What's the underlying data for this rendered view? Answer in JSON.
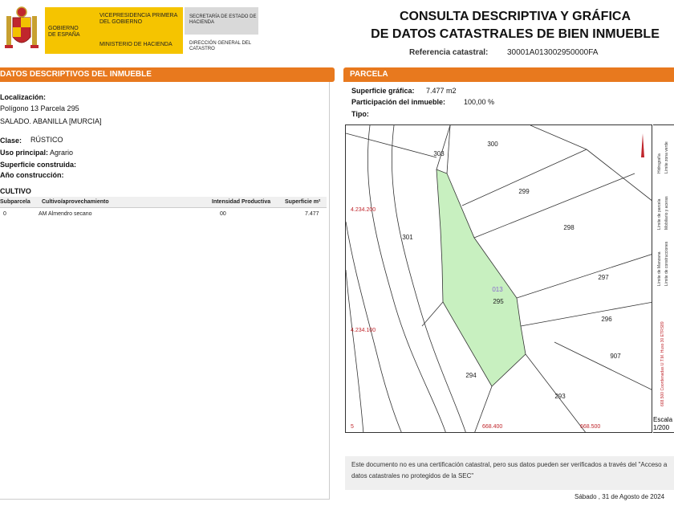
{
  "header": {
    "gobierno": "GOBIERNO DE ESPAÑA",
    "vicepresidencia": "VICEPRESIDENCIA PRIMERA DEL GOBIERNO",
    "ministerio": "MINISTERIO DE HACIENDA",
    "secretaria": "SECRETARÍA DE ESTADO DE HACIENDA",
    "direccion": "DIRECCIÓN GENERAL DEL CATASTRO",
    "title_line1": "CONSULTA DESCRIPTIVA Y GRÁFICA",
    "title_line2": "DE DATOS CATASTRALES DE BIEN INMUEBLE",
    "ref_label": "Referencia catastral:",
    "ref_value": "30001A013002950000FA"
  },
  "left": {
    "section_title": "DATOS DESCRIPTIVOS DEL INMUEBLE",
    "localizacion_label": "Localización:",
    "localizacion_line1": "Polígono 13 Parcela 295",
    "localizacion_line2": "SALADO. ABANILLA [MURCIA]",
    "clase_label": "Clase:",
    "clase_value": "RÚSTICO",
    "uso_label": "Uso principal:",
    "uso_value": "Agrario",
    "superficie_label": "Superficie construida:",
    "anio_label": "Año construcción:",
    "cultivo_title": "CULTIVO",
    "table_headers": [
      "Subparcela",
      "Cultivo/aprovechamiento",
      "Intensidad Productiva",
      "Superficie m²"
    ],
    "table_rows": [
      [
        "0",
        "AM Almendro secano",
        "00",
        "7.477"
      ]
    ]
  },
  "right": {
    "section_title": "PARCELA",
    "superficie_label": "Superficie gráfica:",
    "superficie_value": "7.477 m2",
    "participacion_label": "Participación del inmueble:",
    "participacion_value": "100,00 %",
    "tipo_label": "Tipo:"
  },
  "map": {
    "parcels": [
      "300",
      "303",
      "299",
      "298",
      "301",
      "297",
      "013",
      "295",
      "296",
      "294",
      "907",
      "293"
    ],
    "coords": [
      "4.234.200",
      "4.234.100",
      "668.400",
      "668.500"
    ],
    "y_first_char": "5",
    "highlight_color": "#c8f0c0"
  },
  "legend": {
    "items": [
      "Hidrografía",
      "Límite zona verde",
      "Límite de parcela",
      "Mobiliario y aceras",
      "Límite de Manzana",
      "Límite de construcciones"
    ],
    "coords_text": "668.500 Coordenadas U.T.M. Huso 30 ETRS89",
    "scale_label": "Escala",
    "scale_value": "1/200"
  },
  "footer": {
    "note": "Este documento no es una certificación catastral, pero sus datos pueden ser verificados a través del \"Acceso a datos catastrales no protegidos de la SEC\"",
    "date": "Sábado , 31 de Agosto de 2024"
  }
}
